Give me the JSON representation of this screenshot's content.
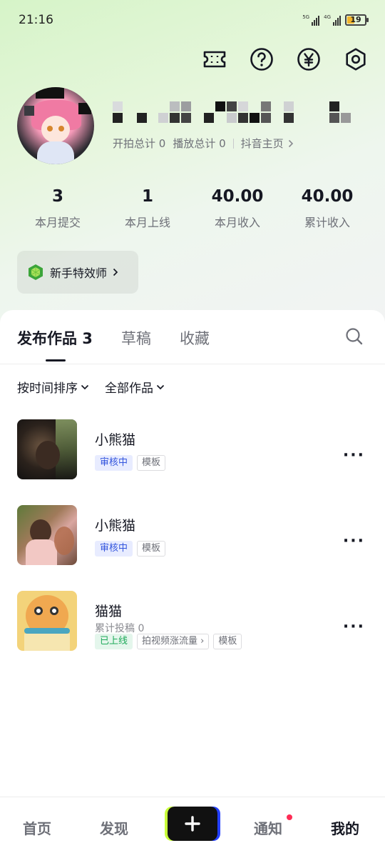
{
  "status_bar": {
    "time": "21:16",
    "network_1": "5G",
    "network_2": "4G",
    "battery": "19",
    "battery_level": 0.19
  },
  "toolbar": {
    "icons": [
      "ticket-icon",
      "help-icon",
      "yen-icon",
      "settings-icon"
    ]
  },
  "profile": {
    "links": {
      "shoot_total": "开拍总计 0",
      "play_total": "播放总计 0",
      "douyin_home": "抖音主页"
    }
  },
  "stats": [
    {
      "value": "3",
      "label": "本月提交"
    },
    {
      "value": "1",
      "label": "本月上线"
    },
    {
      "value": "40.00",
      "label": "本月收入"
    },
    {
      "value": "40.00",
      "label": "累计收入"
    }
  ],
  "badge": {
    "label": "新手特效师"
  },
  "tabs": [
    {
      "label": "发布作品 3",
      "active": true
    },
    {
      "label": "草稿",
      "active": false
    },
    {
      "label": "收藏",
      "active": false
    }
  ],
  "filters": {
    "sort": "按时间排序",
    "category": "全部作品"
  },
  "works": [
    {
      "title": "小熊猫",
      "tags": [
        "审核中",
        "模板"
      ]
    },
    {
      "title": "小熊猫",
      "tags": [
        "审核中",
        "模板"
      ]
    },
    {
      "title": "猫猫",
      "subtitle": "累计投稿 0",
      "tags": [
        "已上线",
        "拍视频涨流量",
        "模板"
      ]
    }
  ],
  "bottom_nav": {
    "home": "首页",
    "discover": "发现",
    "notify": "通知",
    "me": "我的"
  },
  "colors": {
    "accent_red": "#fe2c55",
    "review_blue": "#3355dd",
    "online_green": "#1faa5a"
  }
}
